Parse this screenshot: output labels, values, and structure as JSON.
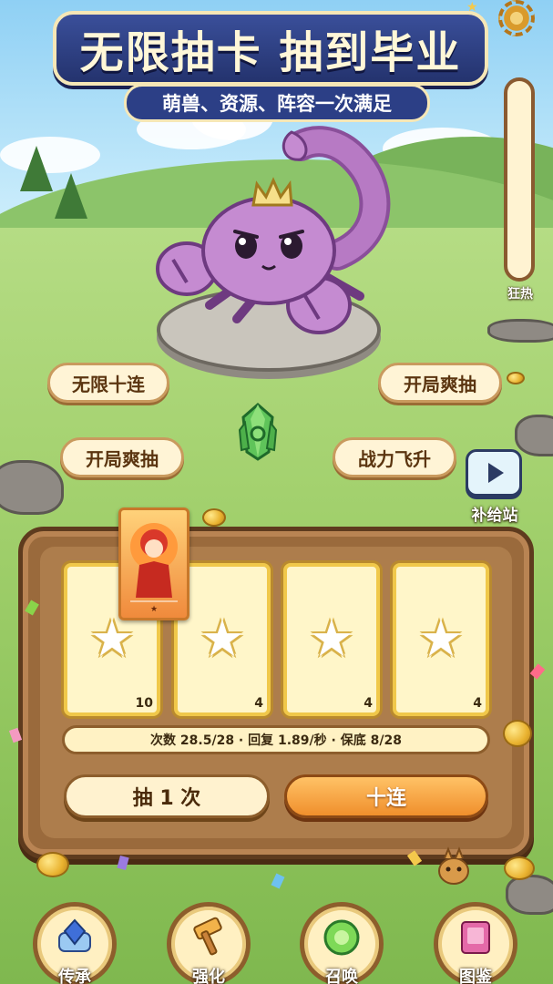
{
  "header": {
    "title": "无限抽卡 抽到毕业",
    "subtitle": "萌兽、资源、阵容一次满足"
  },
  "settings_icon": "gear-icon",
  "frenzy_gauge": {
    "label": "狂热",
    "fill_fraction": 0.0
  },
  "perks": [
    {
      "label": "无限十连"
    },
    {
      "label": "开局爽抽"
    },
    {
      "label": "开局爽抽"
    },
    {
      "label": "战力飞升"
    }
  ],
  "supply_station": {
    "label": "补给站",
    "icon": "play-icon"
  },
  "draw_panel": {
    "slots": [
      {
        "count": "10",
        "icon": "star-icon"
      },
      {
        "count": "4",
        "icon": "star-icon"
      },
      {
        "count": "4",
        "icon": "star-icon"
      },
      {
        "count": "4",
        "icon": "star-icon"
      }
    ],
    "status": "次数 28.5/28 · 回复 1.89/秒 · 保底 8/28",
    "draw_one_label": "抽 1 次",
    "draw_ten_label": "十连"
  },
  "bottom_nav": [
    {
      "label": "传承",
      "icon": "scroll-gem-icon"
    },
    {
      "label": "强化",
      "icon": "hammer-icon"
    },
    {
      "label": "召唤",
      "icon": "summon-orb-icon"
    },
    {
      "label": "图鉴",
      "icon": "book-icon"
    }
  ],
  "colors": {
    "title_banner": "#2c3f86",
    "draw_ten_button": "#f08f2c",
    "card_border": "#f0c84a",
    "wood": "#9a6a3c"
  }
}
